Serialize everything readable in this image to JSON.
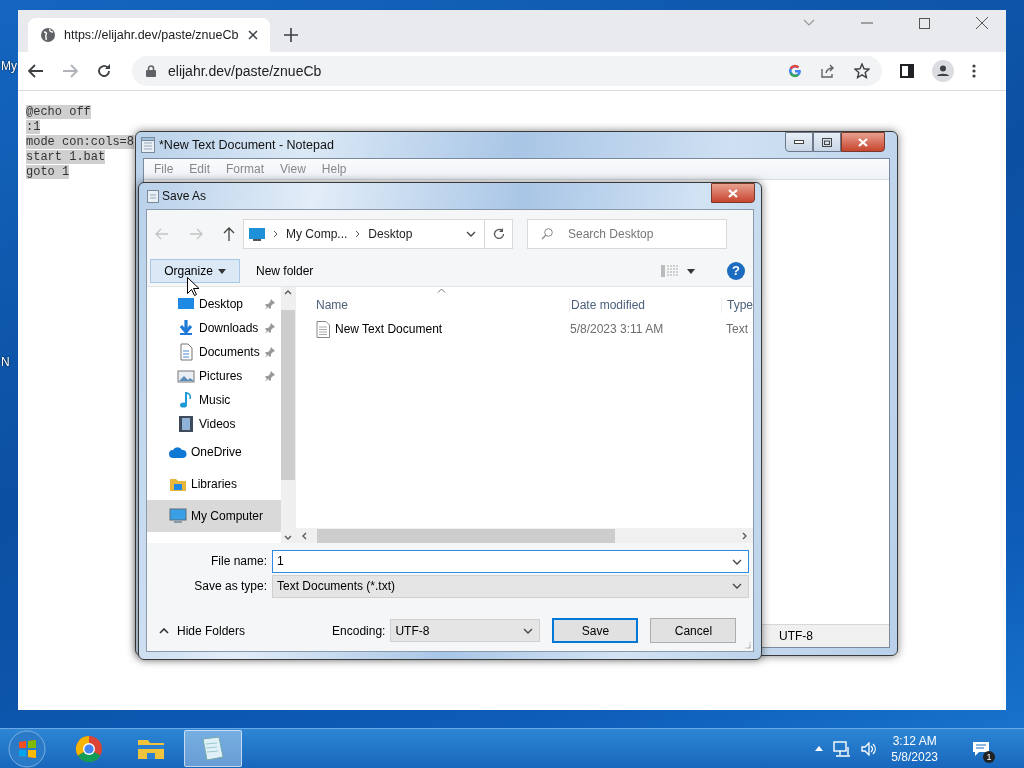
{
  "desktop": {
    "icon_labels": [
      "My",
      "N"
    ]
  },
  "browser": {
    "tab": {
      "title": "https://elijahr.dev/paste/znueCb"
    },
    "address": "elijahr.dev/paste/znueCb",
    "page_lines": [
      "@echo off",
      ":1",
      "mode con:cols=8",
      "start 1.bat",
      "goto 1"
    ]
  },
  "notepad": {
    "title": "*New Text Document - Notepad",
    "menu": [
      "File",
      "Edit",
      "Format",
      "View",
      "Help"
    ],
    "status_encoding": "UTF-8"
  },
  "save_dialog": {
    "title": "Save As",
    "breadcrumb": [
      "My Comp...",
      "Desktop"
    ],
    "search": {
      "placeholder": "Search Desktop"
    },
    "help": "?",
    "organize": {
      "label": "Organize",
      "hovered": true
    },
    "new_folder": "New folder",
    "sidebar": [
      {
        "label": "Desktop",
        "kind": "desktop",
        "pinned": true,
        "selected": false
      },
      {
        "label": "Downloads",
        "kind": "downloads",
        "pinned": true,
        "selected": false
      },
      {
        "label": "Documents",
        "kind": "documents",
        "pinned": true,
        "selected": false
      },
      {
        "label": "Pictures",
        "kind": "pictures",
        "pinned": true,
        "selected": false
      },
      {
        "label": "Music",
        "kind": "music",
        "pinned": false,
        "selected": false
      },
      {
        "label": "Videos",
        "kind": "videos",
        "pinned": false,
        "selected": false
      },
      {
        "label": "OneDrive",
        "kind": "cloud",
        "pinned": false,
        "selected": false
      },
      {
        "label": "Libraries",
        "kind": "libraries",
        "pinned": false,
        "selected": false
      },
      {
        "label": "My Computer",
        "kind": "computer",
        "pinned": false,
        "selected": true
      }
    ],
    "columns": [
      "Name",
      "Date modified",
      "Type"
    ],
    "files": [
      {
        "name": "New Text Document",
        "date": "5/8/2023 3:11 AM",
        "type": "Text"
      }
    ],
    "file_name_label": "File name:",
    "file_name": "1",
    "save_type_label": "Save as type:",
    "save_type": "Text Documents (*.txt)",
    "hide_folders": "Hide Folders",
    "encoding_label": "Encoding:",
    "encoding": "UTF-8",
    "buttons": [
      "Save",
      "Cancel"
    ]
  },
  "taskbar": {
    "apps": [
      {
        "kind": "browser",
        "selected": false
      },
      {
        "kind": "files",
        "selected": false
      },
      {
        "kind": "notepad",
        "selected": true
      }
    ],
    "time": "3:12 AM",
    "date": "5/8/2023",
    "notification_count": "1"
  }
}
